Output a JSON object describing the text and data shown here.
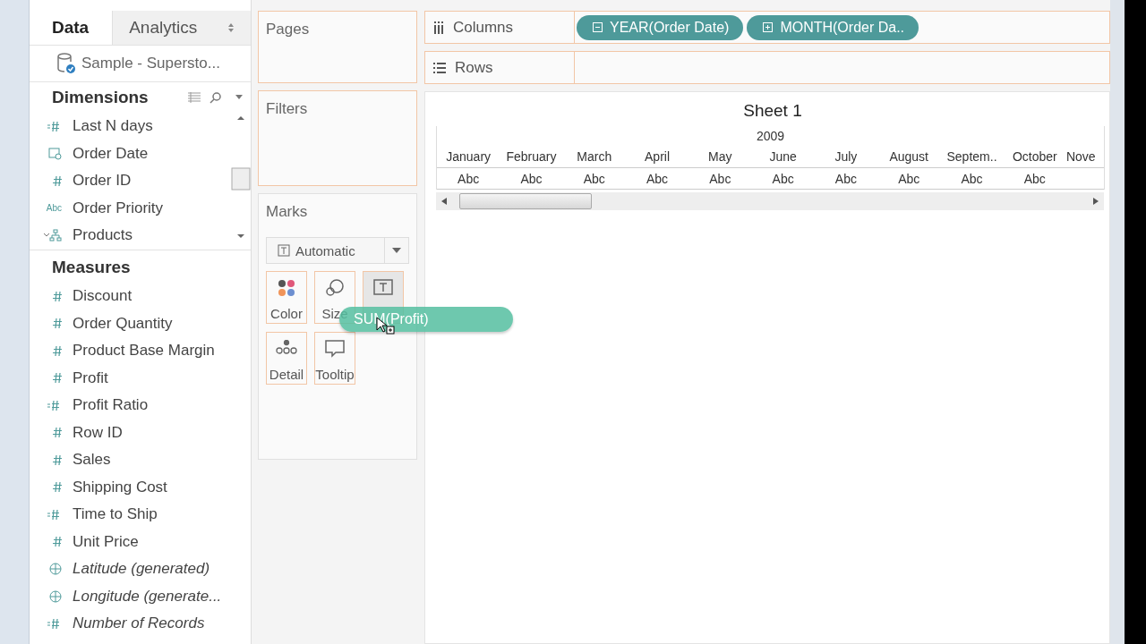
{
  "data_pane": {
    "tabs": [
      {
        "label": "Data",
        "selected": true
      },
      {
        "label": "Analytics",
        "selected": false
      }
    ],
    "data_source": "Sample - Supersto...",
    "dimensions": {
      "title": "Dimensions",
      "fields": [
        {
          "name": "Last N days",
          "kind": "calc"
        },
        {
          "name": "Order Date",
          "kind": "date"
        },
        {
          "name": "Order ID",
          "kind": "number"
        },
        {
          "name": "Order Priority",
          "kind": "string",
          "icon_text": "Abc"
        },
        {
          "name": "Products",
          "kind": "hierarchy",
          "expanded": true
        }
      ]
    },
    "measures": {
      "title": "Measures",
      "fields": [
        {
          "name": "Discount",
          "kind": "number"
        },
        {
          "name": "Order Quantity",
          "kind": "number"
        },
        {
          "name": "Product Base Margin",
          "kind": "number"
        },
        {
          "name": "Profit",
          "kind": "number"
        },
        {
          "name": "Profit Ratio",
          "kind": "calc"
        },
        {
          "name": "Row ID",
          "kind": "number"
        },
        {
          "name": "Sales",
          "kind": "number"
        },
        {
          "name": "Shipping Cost",
          "kind": "number"
        },
        {
          "name": "Time to Ship",
          "kind": "calc"
        },
        {
          "name": "Unit Price",
          "kind": "number"
        },
        {
          "name": "Latitude (generated)",
          "kind": "geo",
          "generated": true
        },
        {
          "name": "Longitude (generate...",
          "kind": "geo",
          "generated": true
        },
        {
          "name": "Number of Records",
          "kind": "calc",
          "generated": true
        }
      ]
    }
  },
  "pages": {
    "title": "Pages"
  },
  "filters": {
    "title": "Filters"
  },
  "marks": {
    "title": "Marks",
    "mark_type": "Automatic",
    "cards": [
      {
        "kind": "color",
        "label": "Color"
      },
      {
        "kind": "size",
        "label": "Size"
      },
      {
        "kind": "text",
        "highlighted": true
      },
      {
        "kind": "detail",
        "label": "Detail"
      },
      {
        "kind": "tooltip",
        "label": "Tooltip"
      }
    ]
  },
  "dragged_pill": "SUM(Profit)",
  "columns_shelf": {
    "label": "Columns",
    "pills": [
      {
        "label": "YEAR(Order Date)",
        "expanded": true
      },
      {
        "label": "MONTH(Order Da..",
        "expanded": false
      }
    ]
  },
  "rows_shelf": {
    "label": "Rows"
  },
  "sheet": {
    "title": "Sheet 1",
    "year": "2009",
    "months": [
      "January",
      "February",
      "March",
      "April",
      "May",
      "June",
      "July",
      "August",
      "Septem..",
      "October",
      "Nove"
    ],
    "cells": [
      "Abc",
      "Abc",
      "Abc",
      "Abc",
      "Abc",
      "Abc",
      "Abc",
      "Abc",
      "Abc",
      "Abc"
    ]
  }
}
